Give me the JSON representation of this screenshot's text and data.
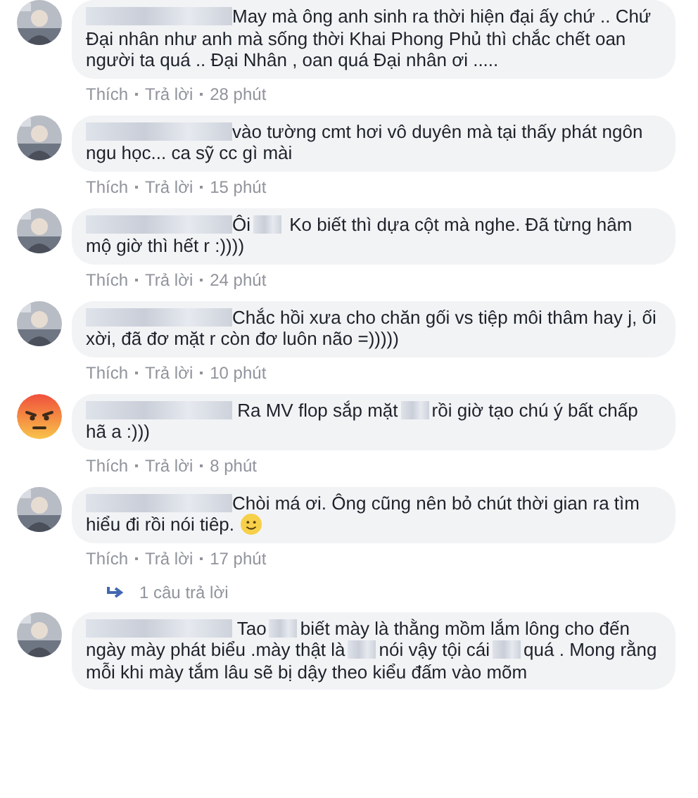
{
  "comments": [
    {
      "parts": [
        {
          "kind": "name_blur"
        },
        {
          "kind": "text",
          "text": "May mà ông anh sinh ra thời hiện đại ấy chứ .. Chứ Đại nhân như anh mà sống thời Khai Phong Phủ thì chắc chết oan người ta quá .. Đại Nhân , oan quá Đại nhân ơi ....."
        }
      ],
      "actions": [
        "Thích",
        "Trả lời",
        "28 phút"
      ]
    },
    {
      "parts": [
        {
          "kind": "name_blur"
        },
        {
          "kind": "text",
          "text": "vào tường cmt hơi vô duyên mà tại thấy phát ngôn ngu học... ca sỹ cc gì mài"
        }
      ],
      "actions": [
        "Thích",
        "Trả lời",
        "15 phút"
      ]
    },
    {
      "parts": [
        {
          "kind": "name_blur"
        },
        {
          "kind": "text",
          "text": "Ôi"
        },
        {
          "kind": "blur"
        },
        {
          "kind": "text",
          "text": " Ko biết thì dựa cột mà nghe. Đã từng hâm mộ giờ thì hết r :))))"
        }
      ],
      "actions": [
        "Thích",
        "Trả lời",
        "24 phút"
      ]
    },
    {
      "parts": [
        {
          "kind": "name_blur"
        },
        {
          "kind": "text",
          "text": "Chắc hồi xưa cho chăn gối vs tiệp môi thâm hay j, ối xời, đã đơ mặt r còn đơ luôn não =)))))"
        }
      ],
      "actions": [
        "Thích",
        "Trả lời",
        "10 phút"
      ]
    },
    {
      "kind": "emoji_avatar",
      "parts": [
        {
          "kind": "name_blur"
        },
        {
          "kind": "text",
          "text": " Ra MV flop sắp mặt"
        },
        {
          "kind": "blur"
        },
        {
          "kind": "text",
          "text": "rồi giờ tạo chú ý bất chấp hã a :)))"
        }
      ],
      "actions": [
        "Thích",
        "Trả lời",
        "8 phút"
      ]
    },
    {
      "parts": [
        {
          "kind": "name_blur"
        },
        {
          "kind": "text",
          "text": "Chòi má ơi. Ông cũng nên bỏ chút thời gian ra tìm hiểu đi rồi nói tiêp."
        },
        {
          "kind": "emoji"
        }
      ],
      "actions": [
        "Thích",
        "Trả lời",
        "17 phút"
      ],
      "replies": "1 câu trả lời"
    },
    {
      "parts": [
        {
          "kind": "name_blur"
        },
        {
          "kind": "text",
          "text": " Tao"
        },
        {
          "kind": "blur"
        },
        {
          "kind": "text",
          "text": "biết mày là thằng mồm lắm lông cho đến ngày mày phát biểu .mày thật là"
        },
        {
          "kind": "blur"
        },
        {
          "kind": "text",
          "text": "nói vậy tội cái"
        },
        {
          "kind": "blur"
        },
        {
          "kind": "text",
          "text": "quá . Mong rằng mỗi khi mày tắm lâu sẽ bị dậy theo kiểu đấm vào mõm"
        }
      ]
    }
  ]
}
